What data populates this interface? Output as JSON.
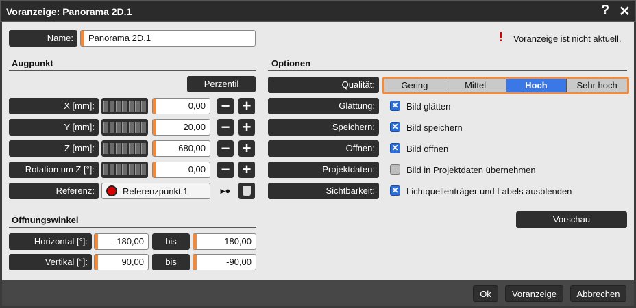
{
  "window": {
    "title": "Voranzeige: Panorama 2D.1",
    "help": "?",
    "close": "✕"
  },
  "name": {
    "label": "Name:",
    "value": "Panorama 2D.1"
  },
  "warning": {
    "icon": "!",
    "text": "Voranzeige ist nicht aktuell."
  },
  "augpunkt": {
    "title": "Augpunkt",
    "perzentil": "Perzentil",
    "rows": [
      {
        "label": "X [mm]:",
        "value": "0,00"
      },
      {
        "label": "Y [mm]:",
        "value": "20,00"
      },
      {
        "label": "Z [mm]:",
        "value": "680,00"
      },
      {
        "label": "Rotation um Z [°]:",
        "value": "0,00"
      }
    ],
    "referenz": {
      "label": "Referenz:",
      "value": "Referenzpunkt.1"
    }
  },
  "oeffnungswinkel": {
    "title": "Öffnungswinkel",
    "bis": "bis",
    "rows": [
      {
        "label": "Horizontal [°]:",
        "from": "-180,00",
        "to": "180,00"
      },
      {
        "label": "Vertikal [°]:",
        "from": "90,00",
        "to": "-90,00"
      }
    ]
  },
  "optionen": {
    "title": "Optionen",
    "qualitaet": {
      "label": "Qualität:",
      "options": [
        "Gering",
        "Mittel",
        "Hoch",
        "Sehr hoch"
      ],
      "selected": "Hoch"
    },
    "rows": [
      {
        "label": "Glättung:",
        "text": "Bild glätten",
        "checked": true
      },
      {
        "label": "Speichern:",
        "text": "Bild speichern",
        "checked": true
      },
      {
        "label": "Öffnen:",
        "text": "Bild öffnen",
        "checked": true
      },
      {
        "label": "Projektdaten:",
        "text": "Bild in Projektdaten übernehmen",
        "checked": false
      },
      {
        "label": "Sichtbarkeit:",
        "text": "Lichtquellenträger und Labels ausblenden",
        "checked": true
      }
    ],
    "vorschau": "Vorschau"
  },
  "footer": {
    "ok": "Ok",
    "voranzeige": "Voranzeige",
    "abbrechen": "Abbrechen"
  },
  "colors": {
    "accent": "#f08a3c",
    "selected": "#3b78e7",
    "warning": "#d40000"
  }
}
